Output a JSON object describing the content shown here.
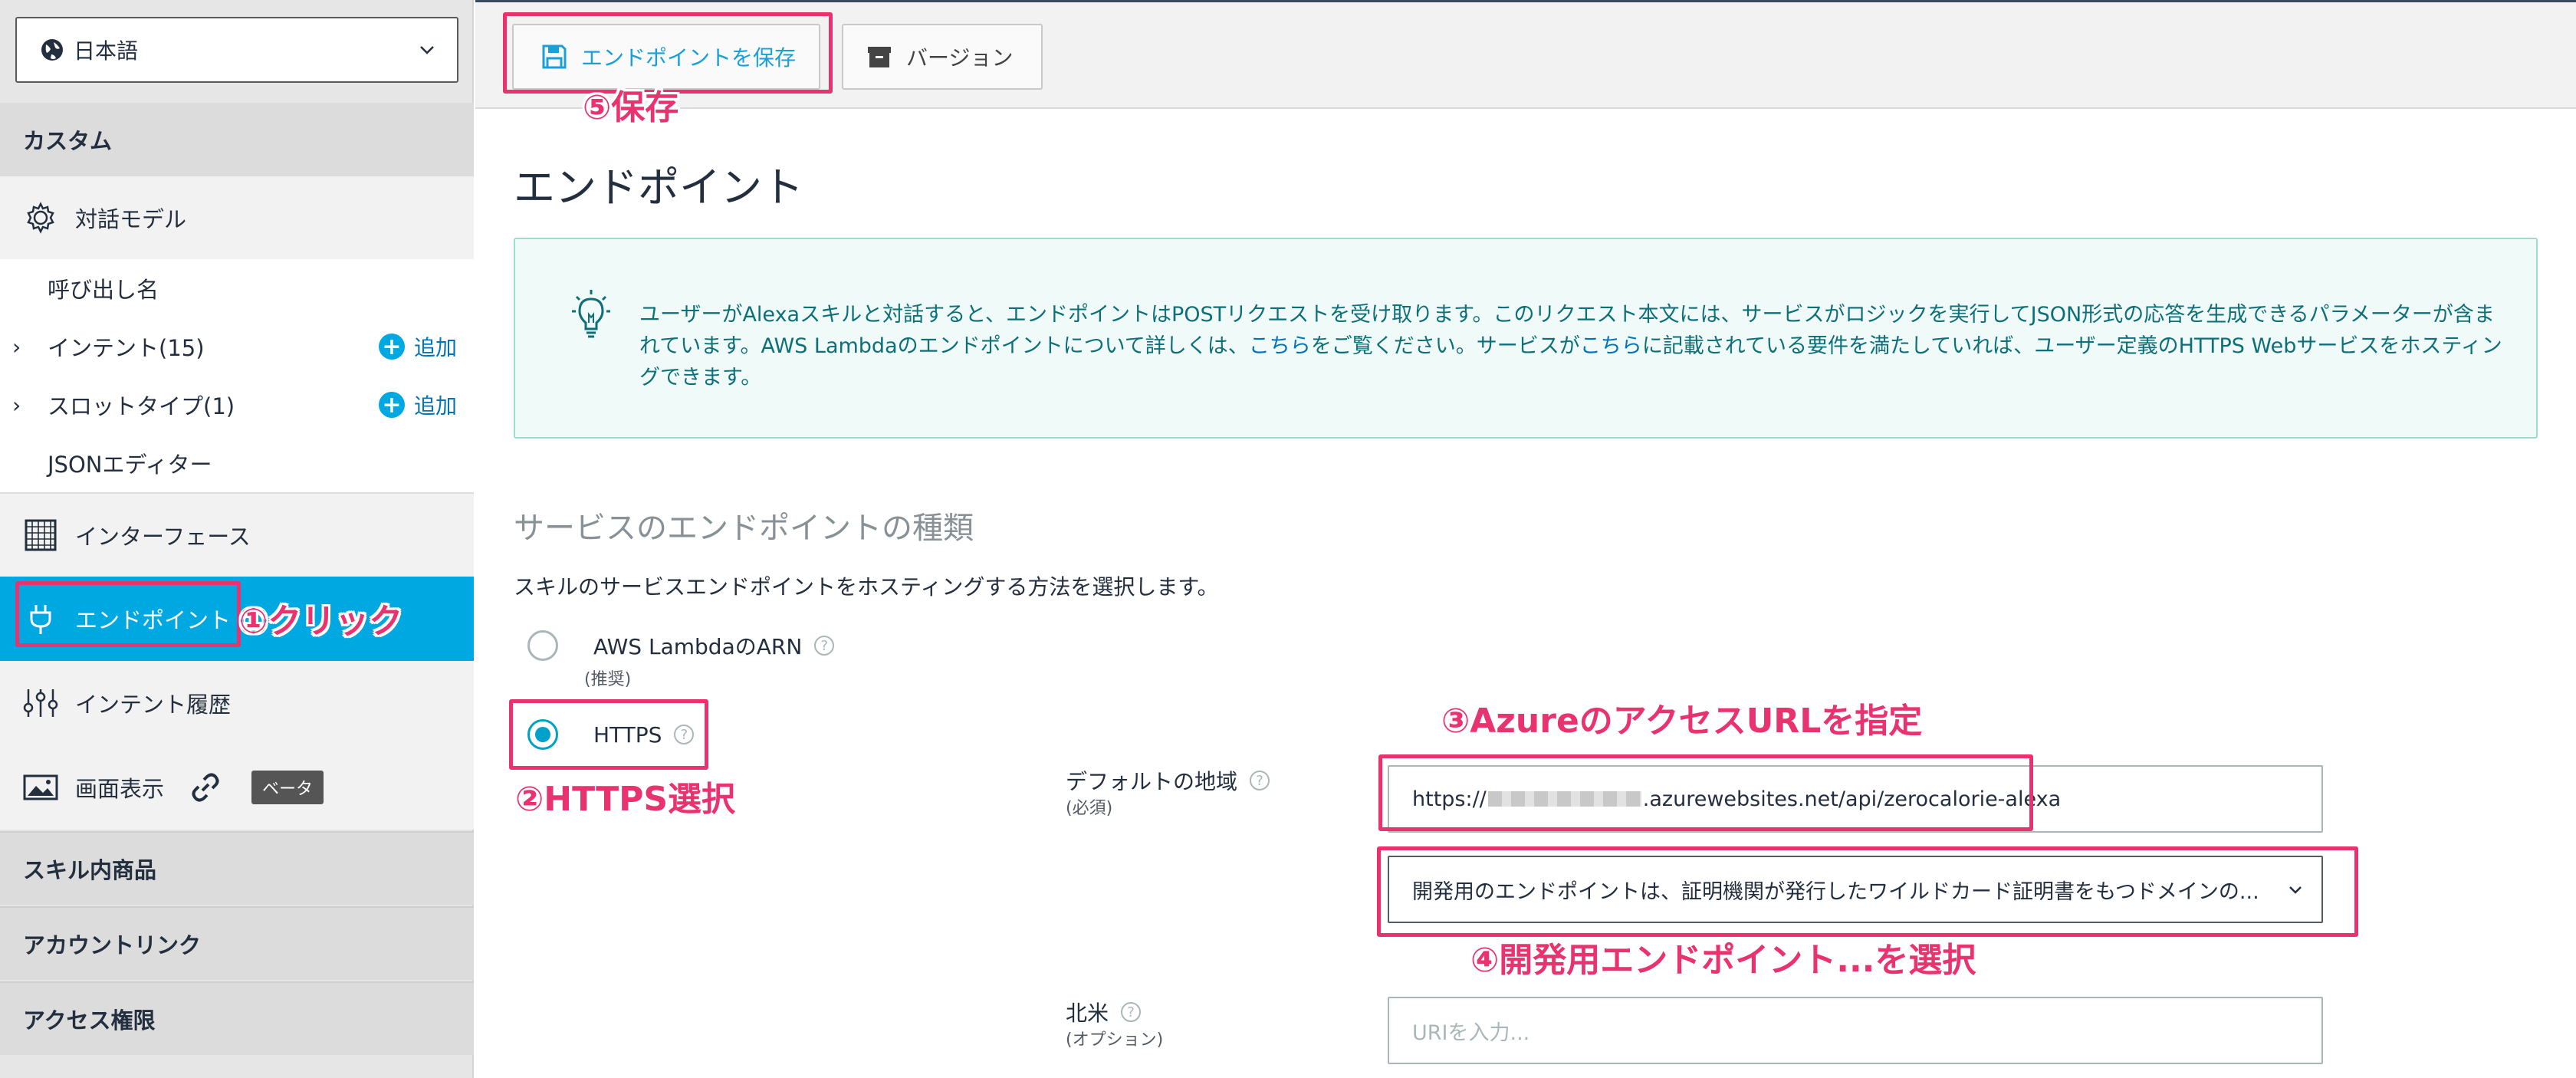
{
  "sidebar": {
    "language": "日本語",
    "custom_header": "カスタム",
    "interaction_model": "対話モデル",
    "invocation_name": "呼び出し名",
    "intents": "インテント(15)",
    "slot_types": "スロットタイプ(1)",
    "add_label": "追加",
    "json_editor": "JSONエディター",
    "interfaces": "インターフェース",
    "endpoint": "エンドポイント",
    "intent_history": "インテント履歴",
    "display": "画面表示",
    "beta_badge": "ベータ",
    "in_skill_products": "スキル内商品",
    "account_linking": "アカウントリンク",
    "permissions": "アクセス権限"
  },
  "toolbar": {
    "save_label": "エンドポイントを保存",
    "version_label": "バージョン"
  },
  "main": {
    "title": "エンドポイント",
    "info_part1": "ユーザーがAlexaスキルと対話すると、エンドポイントはPOSTリクエストを受け取ります。このリクエスト本文には、サービスがロジックを実行してJSON形式の応答を生成できるパラメーターが含まれています。AWS Lambdaのエンドポイントについて詳しくは、",
    "info_link1": "こちら",
    "info_part2": "をご覧ください。サービスが",
    "info_link2": "こちら",
    "info_part3": "に記載されている要件を満たしていれば、ユーザー定義のHTTPS Webサービスをホスティングできます。",
    "section_title": "サービスのエンドポイントの種類",
    "section_desc": "スキルのサービスエンドポイントをホスティングする方法を選択します。",
    "option_lambda": "AWS LambdaのARN",
    "option_lambda_sub": "(推奨)",
    "option_https": "HTTPS",
    "default_region_label": "デフォルトの地域",
    "default_region_sub": "(必須)",
    "url_prefix": "https://",
    "url_suffix": ".azurewebsites.net/api/zerocalorie-alexa",
    "cert_select": "開発用のエンドポイントは、証明機関が発行したワイルドカード証明書をもつドメインの...",
    "north_america_label": "北米",
    "north_america_sub": "(オプション)",
    "uri_placeholder": "URIを入力..."
  },
  "annotations": {
    "step1": "①クリック",
    "step2": "②HTTPS選択",
    "step3": "③AzureのアクセスURLを指定",
    "step4": "④開発用エンドポイント...を選択",
    "step5": "⑤保存"
  },
  "colors": {
    "accent": "#00a8e1",
    "annotation": "#e8336f",
    "link": "#0073bb",
    "info_text": "#0d6f78"
  }
}
